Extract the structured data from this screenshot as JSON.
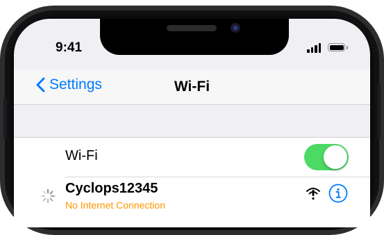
{
  "status_bar": {
    "time": "9:41"
  },
  "navbar": {
    "back_label": "Settings",
    "title": "Wi-Fi"
  },
  "wifi_row": {
    "label": "Wi-Fi",
    "toggle_on": true
  },
  "network": {
    "name": "Cyclops12345",
    "status": "No Internet Connection",
    "status_color": "#ff9500",
    "signal_icon": "wifi-warning-icon",
    "info_icon": "info-icon",
    "loading_icon": "spinner-icon"
  },
  "colors": {
    "accent": "#007aff",
    "toggle_on": "#4cd964",
    "background": "#efeff4"
  }
}
